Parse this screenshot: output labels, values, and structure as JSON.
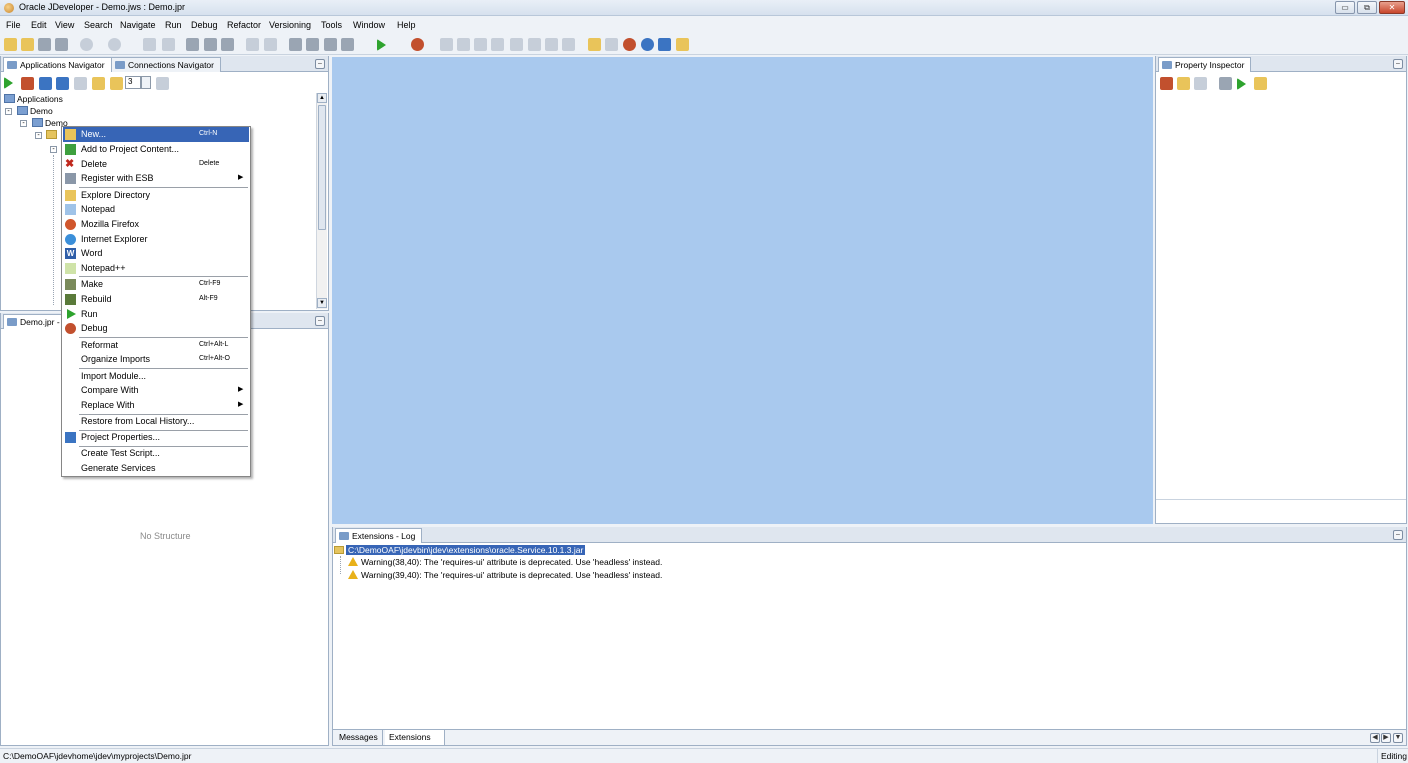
{
  "window": {
    "title": "Oracle JDeveloper - Demo.jws : Demo.jpr",
    "minimize_label": "▭",
    "maximize_label": "⧉",
    "close_label": "✕"
  },
  "menubar": [
    "File",
    "Edit",
    "View",
    "Search",
    "Navigate",
    "Run",
    "Debug",
    "Refactor",
    "Versioning",
    "Tools",
    "Window",
    "Help"
  ],
  "navigator": {
    "tabs": [
      "Applications Navigator",
      "Connections Navigator"
    ],
    "level_value": "3",
    "tree": {
      "root": "Applications",
      "app": "Demo",
      "project": "Demo"
    },
    "minimize": "–"
  },
  "structure": {
    "tab": "Demo.jpr - S",
    "empty_text": "No Structure"
  },
  "context_menu": {
    "items": [
      {
        "label": "New...",
        "shortcut": "Ctrl-N",
        "highlight": true
      },
      {
        "label": "Add to Project Content...",
        "shortcut": ""
      },
      {
        "label": "Delete",
        "shortcut": "Delete"
      },
      {
        "label": "Register with ESB",
        "shortcut": "",
        "submenu": "▶"
      },
      {
        "label": "Explore Directory",
        "shortcut": ""
      },
      {
        "label": "Notepad",
        "shortcut": ""
      },
      {
        "label": "Mozilla Firefox",
        "shortcut": ""
      },
      {
        "label": "Internet Explorer",
        "shortcut": ""
      },
      {
        "label": "Word",
        "shortcut": ""
      },
      {
        "label": "Notepad++",
        "shortcut": ""
      },
      {
        "label": "Make",
        "shortcut": "Ctrl-F9"
      },
      {
        "label": "Rebuild",
        "shortcut": "Alt-F9"
      },
      {
        "label": "Run",
        "shortcut": ""
      },
      {
        "label": "Debug",
        "shortcut": ""
      },
      {
        "label": "Reformat",
        "shortcut": "Ctrl+Alt-L"
      },
      {
        "label": "Organize Imports",
        "shortcut": "Ctrl+Alt-O"
      },
      {
        "label": "Import Module...",
        "shortcut": ""
      },
      {
        "label": "Compare With",
        "shortcut": "",
        "submenu": "▶"
      },
      {
        "label": "Replace With",
        "shortcut": "",
        "submenu": "▶"
      },
      {
        "label": "Restore from Local History...",
        "shortcut": ""
      },
      {
        "label": "Project Properties...",
        "shortcut": ""
      },
      {
        "label": "Create Test Script...",
        "shortcut": ""
      },
      {
        "label": "Generate Services",
        "shortcut": ""
      }
    ]
  },
  "property_inspector": {
    "tab": "Property Inspector",
    "minimize": "–"
  },
  "log": {
    "tab": "Extensions - Log",
    "path": "C:\\DemoOAF\\jdevbin\\jdev\\extensions\\oracle.Service.10.1.3.jar",
    "warnings": [
      "Warning(38,40): The 'requires-ui' attribute is deprecated. Use 'headless' instead.",
      "Warning(39,40): The 'requires-ui' attribute is deprecated. Use 'headless' instead."
    ],
    "bottom_tabs": [
      "Messages",
      "Extensions"
    ],
    "minimize": "–",
    "nav_left": "◀",
    "nav_right": "▶",
    "nav_down": "▼"
  },
  "statusbar": {
    "path": "C:\\DemoOAF\\jdevhome\\jdev\\myprojects\\Demo.jpr",
    "mode": "Editing"
  },
  "colors": {
    "editor_bg": "#a9c9ee",
    "menu_highlight": "#3765b6"
  }
}
